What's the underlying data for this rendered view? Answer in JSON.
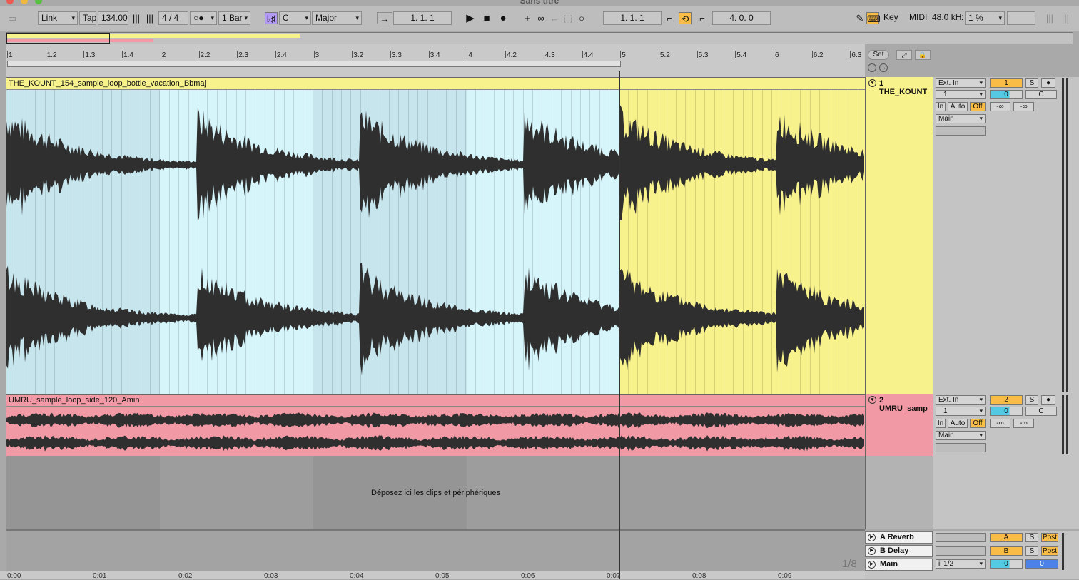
{
  "window": {
    "title": "Sans titre"
  },
  "toolbar": {
    "link": "Link",
    "tap": "Tap",
    "tempo": "134.00",
    "signature": "4 / 4",
    "quantize": "1 Bar",
    "key_root": "C",
    "scale": "Major",
    "arrangement_position": "1.  1.  1",
    "loop_start": "1.  1.  1",
    "loop_length": "4.  0.  0",
    "set_label": "Set",
    "key_label": "Key",
    "midi_label": "MIDI",
    "sample_rate": "48.0 kHz",
    "cpu": "1 %"
  },
  "ruler": {
    "ticks": [
      "1",
      "1.2",
      "1.3",
      "1.4",
      "2",
      "2.2",
      "2.3",
      "2.4",
      "3",
      "3.2",
      "3.3",
      "3.4",
      "4",
      "4.2",
      "4.3",
      "4.4",
      "5",
      "5.2",
      "5.3",
      "5.4",
      "6",
      "6.2",
      "6.3"
    ]
  },
  "tracks": [
    {
      "clip_name": "THE_KOUNT_154_sample_loop_bottle_vacation_Bbmaj",
      "header_name": "1 THE_KOUNT",
      "input": "Ext. In",
      "channel": "1",
      "monitor": [
        "In",
        "Auto",
        "Off"
      ],
      "output": "Main",
      "number": "1",
      "solo": "S",
      "volume": "0",
      "pan": "C",
      "send_a": "-∞",
      "send_b": "-∞",
      "color": "#f7f28c"
    },
    {
      "clip_name": "UMRU_sample_loop_side_120_Amin",
      "header_name": "2 UMRU_samp",
      "input": "Ext. In",
      "channel": "1",
      "monitor": [
        "In",
        "Auto",
        "Off"
      ],
      "output": "Main",
      "number": "2",
      "solo": "S",
      "volume": "0",
      "pan": "C",
      "send_a": "-∞",
      "send_b": "-∞",
      "color": "#f19aa5"
    }
  ],
  "drop_text": "Déposez ici les clips et périphériques",
  "returns": [
    {
      "name": "A Reverb",
      "letter": "A",
      "solo": "S",
      "post": "Post"
    },
    {
      "name": "B Delay",
      "letter": "B",
      "solo": "S",
      "post": "Post"
    }
  ],
  "main": {
    "name": "Main",
    "output": "ii 1/2",
    "volume": "0",
    "pan": "0"
  },
  "grid": "1/8",
  "timeline": [
    "0:00",
    "0:01",
    "0:02",
    "0:03",
    "0:04",
    "0:05",
    "0:06",
    "0:07",
    "0:08",
    "0:09"
  ]
}
